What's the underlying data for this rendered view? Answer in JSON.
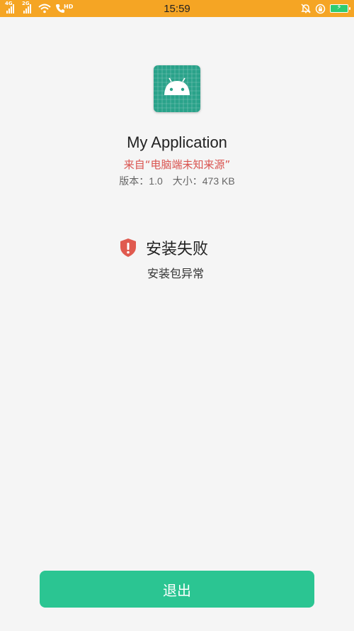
{
  "status_bar": {
    "time": "15:59",
    "network_1": "4G",
    "network_2": "2G",
    "hd_label": "HD",
    "background_color": "#f5a524",
    "icons": [
      "signal-4g-icon",
      "signal-2g-icon",
      "wifi-icon",
      "hd-call-icon",
      "alarm-off-icon",
      "lock-rotation-icon",
      "battery-charging-icon"
    ]
  },
  "app": {
    "icon": "android-app-icon",
    "icon_color": "#2aa28a",
    "name": "My Application",
    "source": "来自“电脑端未知来源”",
    "version_label": "版本：1.0",
    "size_label": "大小：473 KB"
  },
  "install_result": {
    "icon": "shield-warning-icon",
    "icon_color": "#e05a4f",
    "title": "安装失败",
    "reason": "安装包异常"
  },
  "actions": {
    "exit_label": "退出",
    "exit_color": "#2bc592"
  }
}
